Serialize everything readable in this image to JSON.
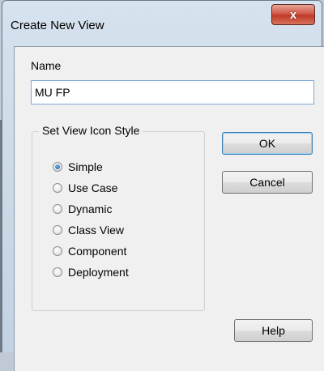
{
  "dialog": {
    "title": "Create New View",
    "close_glyph": "x",
    "name_label": "Name",
    "name_value": "MU FP",
    "group_title": "Set View Icon Style",
    "options": [
      {
        "label": "Simple",
        "checked": true
      },
      {
        "label": "Use Case",
        "checked": false
      },
      {
        "label": "Dynamic",
        "checked": false
      },
      {
        "label": "Class View",
        "checked": false
      },
      {
        "label": "Component",
        "checked": false
      },
      {
        "label": "Deployment",
        "checked": false
      }
    ],
    "buttons": {
      "ok": "OK",
      "cancel": "Cancel",
      "help": "Help"
    }
  }
}
